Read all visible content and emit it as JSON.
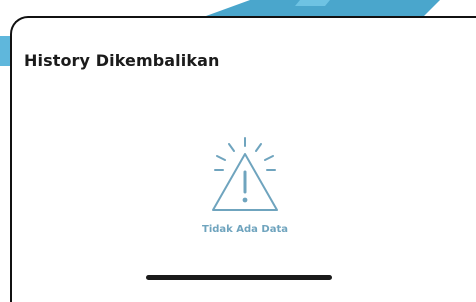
{
  "page": {
    "title": "History Dikembalikan"
  },
  "empty_state": {
    "icon": "warning-triangle-icon",
    "message": "Tidak Ada Data"
  },
  "colors": {
    "accent": "#6fa4be",
    "title_text": "#1b1b1b",
    "banner": "#4aa6cc",
    "border": "#111111"
  }
}
